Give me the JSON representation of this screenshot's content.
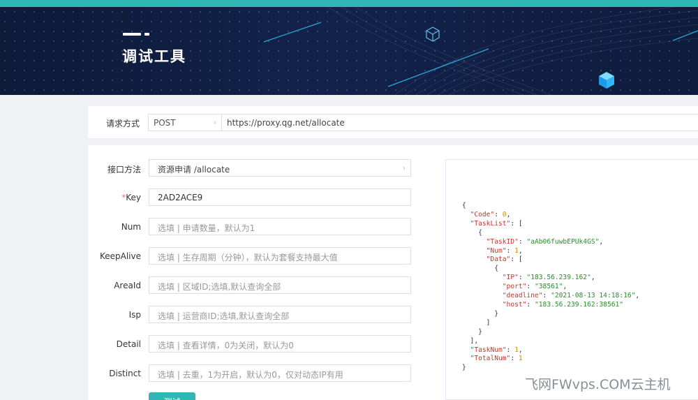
{
  "page": {
    "title": "调试工具"
  },
  "request": {
    "label": "请求方式",
    "method": "POST",
    "url": "https://proxy.qg.net/allocate"
  },
  "form": {
    "fields": [
      {
        "label": "接口方法",
        "value": "资源申请  /allocate",
        "kind": "select"
      },
      {
        "label": "Key",
        "required_mark": "*",
        "value": "2AD2ACE9",
        "kind": "filled"
      },
      {
        "label": "Num",
        "placeholder": "选填 | 申请数量，默认为1"
      },
      {
        "label": "KeepAlive",
        "placeholder": "选填 | 生存周期（分钟），默认为套餐支持最大值"
      },
      {
        "label": "AreaId",
        "placeholder": "选填 | 区域ID;选填,默认查询全部"
      },
      {
        "label": "Isp",
        "placeholder": "选填 | 运营商ID;选填,默认查询全部"
      },
      {
        "label": "Detail",
        "placeholder": "选填 | 查看详情，0为关闭，默认为0"
      },
      {
        "label": "Distinct",
        "placeholder": "选填 | 去重，1为开启，默认为0，仅对动态IP有用"
      }
    ],
    "submit_label": "测试"
  },
  "response": {
    "code": 0,
    "task_id": "aAb06fuwbEPUk4GS",
    "num": 1,
    "ip": "183.56.239.162",
    "port": "38561",
    "deadline": "2021-08-13 14:18:16",
    "host": "183.56.239.162:38561",
    "task_num": 1,
    "total_num": 1
  },
  "watermark": "飞网FWvps.COM云主机",
  "colors": {
    "accent": "#2fb7b6",
    "banner": "#12224a",
    "required": "#f56c6c"
  },
  "icons": [
    "chevron-right-icon",
    "cube-outline-icon",
    "cube-icon"
  ]
}
